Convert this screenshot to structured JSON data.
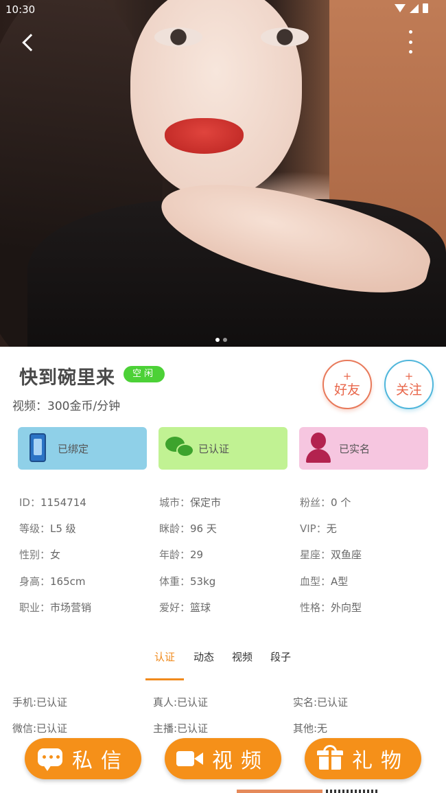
{
  "status_bar": {
    "time": "10:30"
  },
  "hero": {
    "carousel_total": 2,
    "carousel_active": 1
  },
  "profile": {
    "name": "快到碗里来",
    "status": "空闲",
    "price": "视频：300金币/分钟"
  },
  "actions_top": {
    "friend": {
      "plus": "+",
      "label": "好友"
    },
    "follow": {
      "plus": "+",
      "label": "关注"
    }
  },
  "verification": [
    {
      "label": "已绑定",
      "icon": "phone-icon"
    },
    {
      "label": "已认证",
      "icon": "wechat-icon"
    },
    {
      "label": "已实名",
      "icon": "person-icon"
    }
  ],
  "info": [
    [
      {
        "k": "ID：",
        "v": "1154714"
      },
      {
        "k": "城市：",
        "v": "保定市"
      },
      {
        "k": "粉丝：",
        "v": "0 个"
      }
    ],
    [
      {
        "k": "等级：",
        "v": "L5 级"
      },
      {
        "k": "眯龄：",
        "v": "96 天"
      },
      {
        "k": "VIP：",
        "v": "无"
      }
    ],
    [
      {
        "k": "性别：",
        "v": "女"
      },
      {
        "k": "年龄：",
        "v": "29"
      },
      {
        "k": "星座：",
        "v": "双鱼座"
      }
    ],
    [
      {
        "k": "身高：",
        "v": "165cm"
      },
      {
        "k": "体重：",
        "v": "53kg"
      },
      {
        "k": "血型：",
        "v": "A型"
      }
    ],
    [
      {
        "k": "职业：",
        "v": "市场营销"
      },
      {
        "k": "爱好：",
        "v": "篮球"
      },
      {
        "k": "性格：",
        "v": "外向型"
      }
    ]
  ],
  "tabs": [
    "认证",
    "动态",
    "视频",
    "段子"
  ],
  "certs": [
    [
      "手机:已认证",
      "真人:已认证",
      "实名:已认证"
    ],
    [
      "微信:已认证",
      "主播:已认证",
      "其他:无"
    ]
  ],
  "bottom_actions": {
    "message": "私信",
    "video": "视频",
    "gift": "礼物"
  },
  "colors": {
    "accent": "#f59019",
    "status_green": "#4cd137",
    "phone_card": "#8fd0e8",
    "wechat_card": "#c1f293",
    "realname_card": "#f6c6e0"
  }
}
